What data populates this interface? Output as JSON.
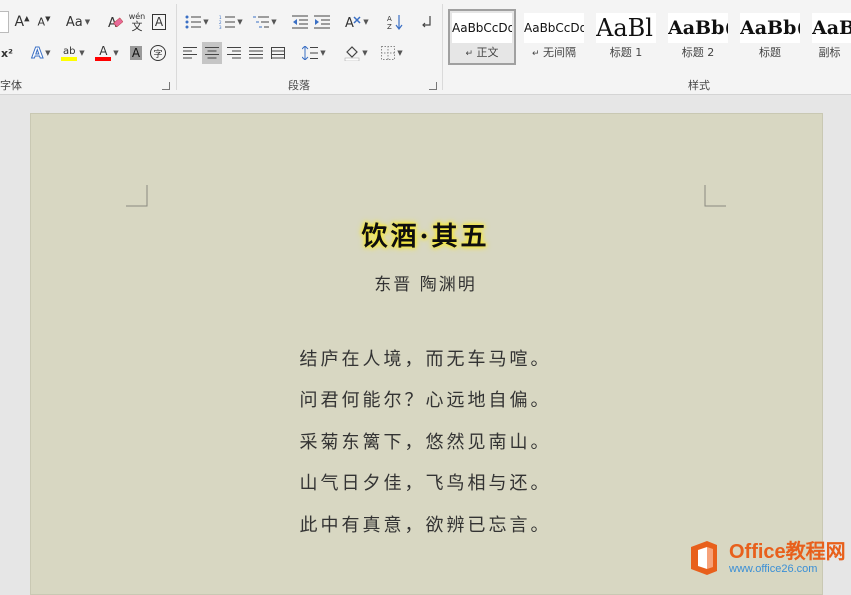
{
  "ribbon": {
    "font_group_label": "字体",
    "paragraph_group_label": "段落",
    "styles_group_label": "样式",
    "font_buttons": {
      "grow": "A",
      "shrink": "A",
      "change_case": "Aa",
      "phonetic_top": "wén",
      "phonetic_bottom": "文",
      "char_border": "A",
      "superscript": "x²",
      "text_effects": "A",
      "highlight": "ab",
      "font_color": "A",
      "char_shading": "A",
      "enclose_char": "字"
    },
    "styles": [
      {
        "preview": "AaBbCcDd",
        "name": "正文",
        "marker": "↵",
        "selected": true
      },
      {
        "preview": "AaBbCcDd",
        "name": "无间隔",
        "marker": "↵",
        "selected": false
      },
      {
        "preview": "AaBl",
        "name": "标题 1",
        "marker": "",
        "selected": false
      },
      {
        "preview": "AaBb(",
        "name": "标题 2",
        "marker": "",
        "selected": false
      },
      {
        "preview": "AaBb(",
        "name": "标题",
        "marker": "",
        "selected": false
      },
      {
        "preview": "AaB",
        "name": "副标",
        "marker": "",
        "selected": false
      }
    ],
    "colors": {
      "highlight_bar": "#ffff00",
      "font_color_bar": "#ff0000",
      "ribbon_bg": "#f4f4f4"
    }
  },
  "document": {
    "title": "饮酒·其五",
    "author": "东晋 陶渊明",
    "lines": [
      "结庐在人境，而无车马喧。",
      "问君何能尔？心远地自偏。",
      "采菊东篱下，悠然见南山。",
      "山气日夕佳，飞鸟相与还。",
      "此中有真意，欲辨已忘言。"
    ],
    "page_color": "#d8d7c2",
    "title_glow_color": "#f5e83a"
  },
  "watermark": {
    "title": "Office教程网",
    "url": "www.office26.com",
    "logo_color": "#e8601c"
  }
}
